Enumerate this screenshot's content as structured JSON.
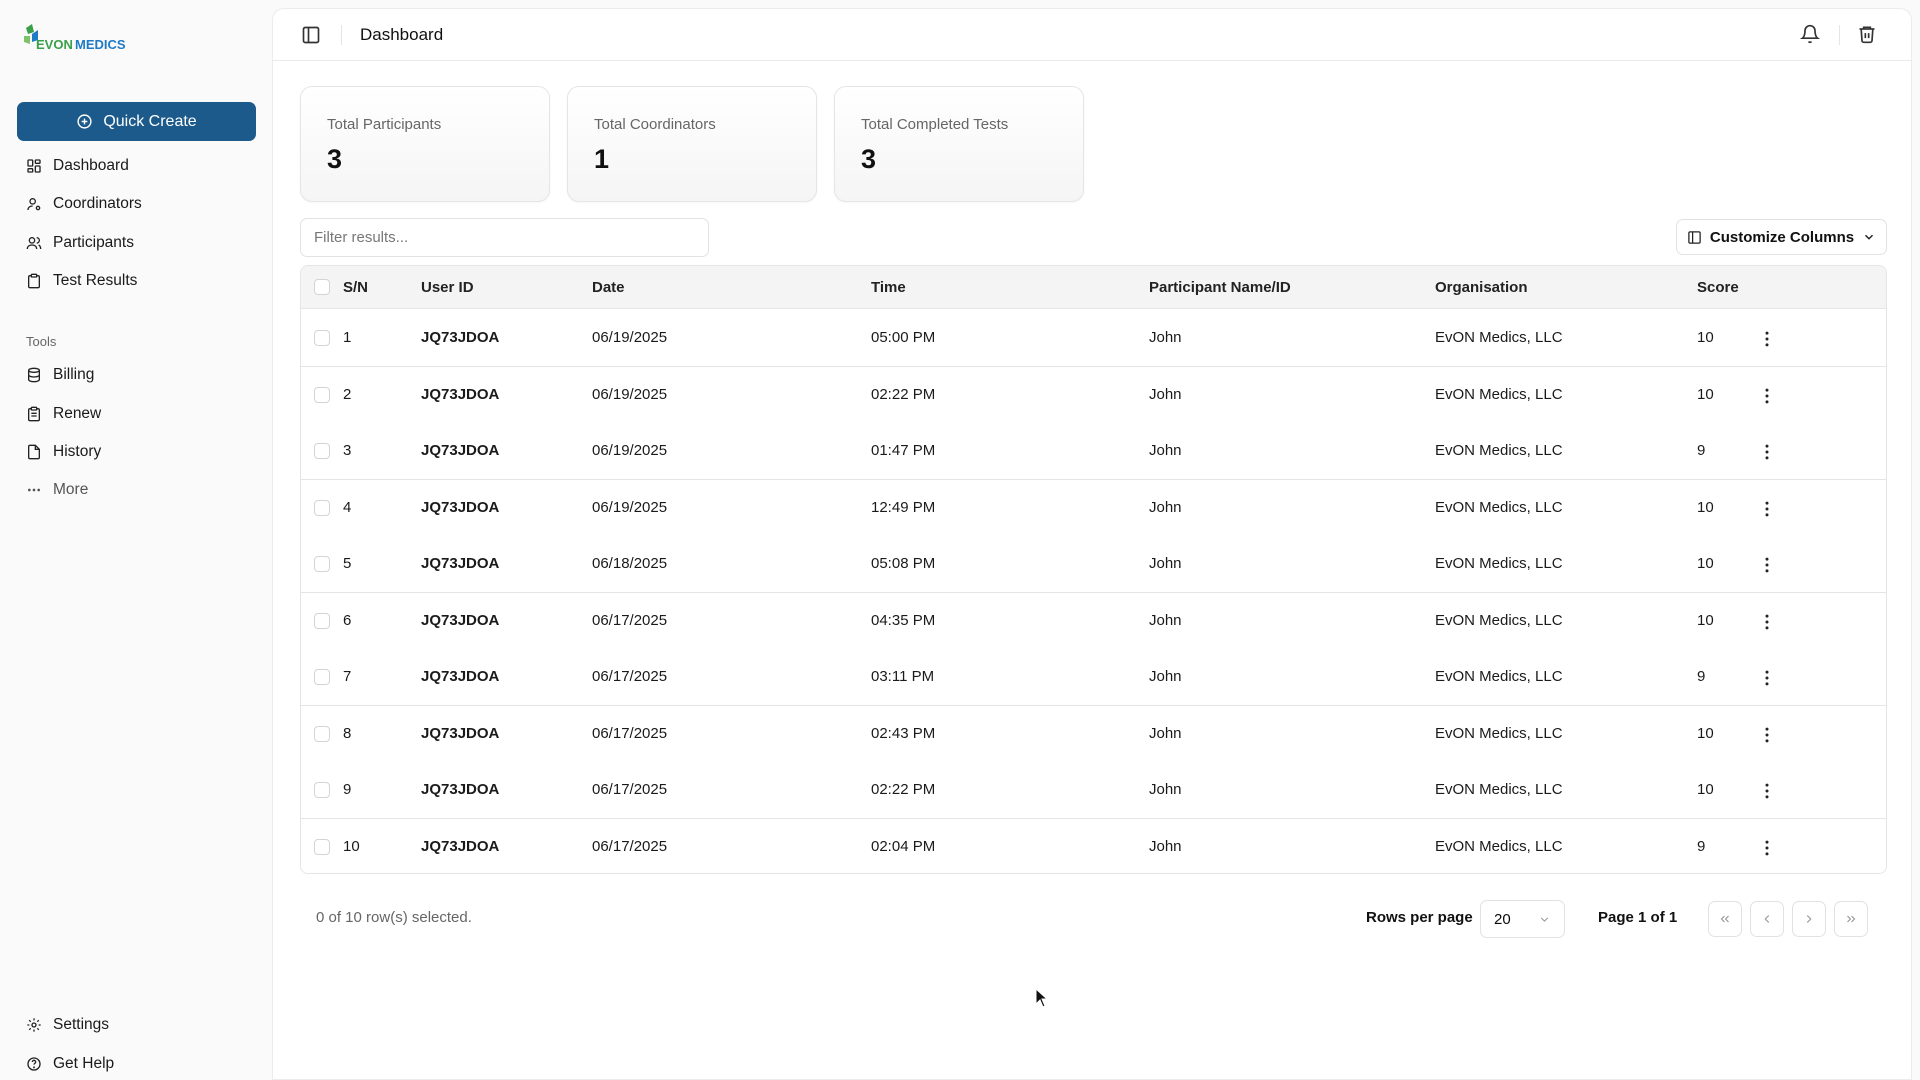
{
  "brand": {
    "logo_text": "EVONMEDICS",
    "logo_green": "#3aa04a",
    "logo_blue": "#1f7bc4",
    "accent": "#1b5a8a"
  },
  "sidebar": {
    "quick_create": "Quick Create",
    "nav": [
      {
        "label": "Dashboard",
        "icon": "dashboard-icon"
      },
      {
        "label": "Coordinators",
        "icon": "user-cog-icon"
      },
      {
        "label": "Participants",
        "icon": "users-icon"
      },
      {
        "label": "Test Results",
        "icon": "clipboard-icon"
      }
    ],
    "tools_label": "Tools",
    "tools": [
      {
        "label": "Billing",
        "icon": "database-icon"
      },
      {
        "label": "Renew",
        "icon": "clipboard-list-icon"
      },
      {
        "label": "History",
        "icon": "file-icon"
      },
      {
        "label": "More",
        "icon": "ellipsis-icon"
      }
    ],
    "footer": [
      {
        "label": "Settings",
        "icon": "gear-icon"
      },
      {
        "label": "Get Help",
        "icon": "help-icon"
      }
    ]
  },
  "header": {
    "title": "Dashboard"
  },
  "stats": [
    {
      "label": "Total Participants",
      "value": "3"
    },
    {
      "label": "Total Coordinators",
      "value": "1"
    },
    {
      "label": "Total Completed Tests",
      "value": "3"
    }
  ],
  "filter": {
    "placeholder": "Filter results...",
    "value": ""
  },
  "customize_columns": "Customize Columns",
  "table": {
    "columns": [
      "S/N",
      "User ID",
      "Date",
      "Time",
      "Participant Name/ID",
      "Organisation",
      "Score"
    ],
    "rows": [
      [
        "1",
        "JQ73JDOA",
        "06/19/2025",
        "05:00 PM",
        "John",
        "EvON Medics, LLC",
        "10"
      ],
      [
        "2",
        "JQ73JDOA",
        "06/19/2025",
        "02:22 PM",
        "John",
        "EvON Medics, LLC",
        "10"
      ],
      [
        "3",
        "JQ73JDOA",
        "06/19/2025",
        "01:47 PM",
        "John",
        "EvON Medics, LLC",
        "9"
      ],
      [
        "4",
        "JQ73JDOA",
        "06/19/2025",
        "12:49 PM",
        "John",
        "EvON Medics, LLC",
        "10"
      ],
      [
        "5",
        "JQ73JDOA",
        "06/18/2025",
        "05:08 PM",
        "John",
        "EvON Medics, LLC",
        "10"
      ],
      [
        "6",
        "JQ73JDOA",
        "06/17/2025",
        "04:35 PM",
        "John",
        "EvON Medics, LLC",
        "10"
      ],
      [
        "7",
        "JQ73JDOA",
        "06/17/2025",
        "03:11 PM",
        "John",
        "EvON Medics, LLC",
        "9"
      ],
      [
        "8",
        "JQ73JDOA",
        "06/17/2025",
        "02:43 PM",
        "John",
        "EvON Medics, LLC",
        "10"
      ],
      [
        "9",
        "JQ73JDOA",
        "06/17/2025",
        "02:22 PM",
        "John",
        "EvON Medics, LLC",
        "10"
      ],
      [
        "10",
        "JQ73JDOA",
        "06/17/2025",
        "02:04 PM",
        "John",
        "EvON Medics, LLC",
        "9"
      ]
    ]
  },
  "footer": {
    "selected_text": "0 of 10 row(s) selected.",
    "rows_per_page_label": "Rows per page",
    "rows_per_page_value": "20",
    "page_info": "Page 1 of 1"
  }
}
